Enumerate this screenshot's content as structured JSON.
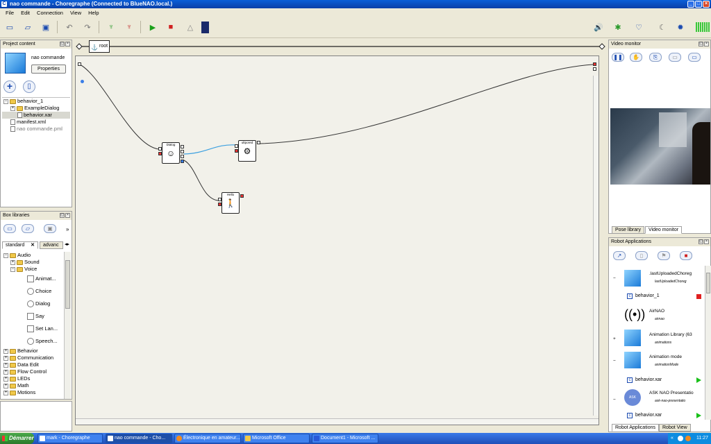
{
  "window": {
    "title": "nao commande - Choregraphe (Connected to BlueNAO.local.)"
  },
  "menu": [
    "File",
    "Edit",
    "Connection",
    "View",
    "Help"
  ],
  "breadcrumb": {
    "root_label": "root"
  },
  "project": {
    "title": "Project content",
    "name": "nao commande",
    "properties_label": "Properties",
    "tree": [
      {
        "label": "behavior_1",
        "level": 0,
        "type": "folder"
      },
      {
        "label": "ExampleDialog",
        "level": 1,
        "type": "folder"
      },
      {
        "label": "behavior.xar",
        "level": 1,
        "type": "file"
      },
      {
        "label": "manifest.xml",
        "level": 0,
        "type": "file"
      },
      {
        "label": "nao commande.pml",
        "level": 0,
        "type": "file"
      }
    ]
  },
  "box_libraries": {
    "title": "Box libraries",
    "tabs": [
      "standard",
      "advanc"
    ],
    "tree": [
      {
        "label": "Audio",
        "level": 0,
        "type": "folder"
      },
      {
        "label": "Sound",
        "level": 1,
        "type": "folder"
      },
      {
        "label": "Voice",
        "level": 1,
        "type": "folder"
      },
      {
        "label": "Animat...",
        "level": 2,
        "type": "box"
      },
      {
        "label": "Choice",
        "level": 2,
        "type": "box"
      },
      {
        "label": "Dialog",
        "level": 2,
        "type": "box"
      },
      {
        "label": "Say",
        "level": 2,
        "type": "box"
      },
      {
        "label": "Set Lan...",
        "level": 2,
        "type": "box"
      },
      {
        "label": "Speech...",
        "level": 2,
        "type": "box"
      },
      {
        "label": "Behavior",
        "level": 0,
        "type": "folder"
      },
      {
        "label": "Communication",
        "level": 0,
        "type": "folder"
      },
      {
        "label": "Data Edit",
        "level": 0,
        "type": "folder"
      },
      {
        "label": "Flow Control",
        "level": 0,
        "type": "folder"
      },
      {
        "label": "LEDs",
        "level": 0,
        "type": "folder"
      },
      {
        "label": "Math",
        "level": 0,
        "type": "folder"
      },
      {
        "label": "Motions",
        "level": 0,
        "type": "folder"
      }
    ]
  },
  "canvas": {
    "boxes": {
      "dialog": "Dialog",
      "upload": "ultpored",
      "hello": "Hello"
    }
  },
  "video_monitor": {
    "title": "Video monitor",
    "tabs": [
      "Pose library",
      "Video monitor"
    ]
  },
  "robot_apps": {
    "title": "Robot Applications",
    "items": [
      {
        "name": ".lastUploadedChoreg",
        "sub": "lastUploadedChoreg",
        "kind": "app"
      },
      {
        "name": "behavior_1",
        "kind": "behavior",
        "status": "stopped"
      },
      {
        "name": "AirNAO",
        "sub": "airnao",
        "kind": "app"
      },
      {
        "name": "Animation Library (63",
        "sub": "animations",
        "kind": "app"
      },
      {
        "name": "Animation mode",
        "sub": "animationMode",
        "kind": "app"
      },
      {
        "name": "behavior.xar",
        "kind": "behavior",
        "status": "play"
      },
      {
        "name": "ASK NAO Presentatio",
        "sub": "ask-nao-presentatio",
        "kind": "app"
      },
      {
        "name": "behavior.xar",
        "kind": "behavior",
        "status": "play"
      }
    ],
    "bottom_tabs": [
      "Robot Applications",
      "Robot View"
    ]
  },
  "taskbar": {
    "start_label": "Démarrer",
    "tasks": [
      "mark - Choregraphe",
      "nao commande - Cho...",
      "Électronique en amateur...",
      "Microsoft Office",
      "Document1 - Microsoft ..."
    ],
    "clock": "11:27",
    "tray_prefix": "«"
  },
  "colors": {
    "accent": "#1a4ab0",
    "titlebar": "#0a3fa8",
    "canvas": "#f2f1ea"
  }
}
